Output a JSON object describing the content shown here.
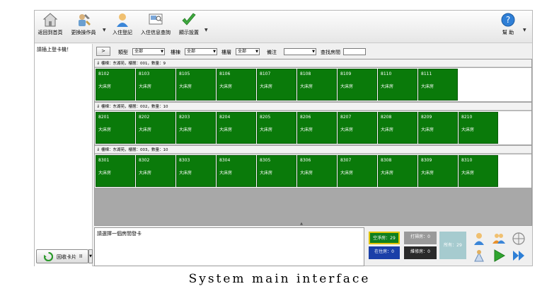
{
  "toolbar": {
    "items": [
      {
        "label": "返回到首頁",
        "icon": "home-icon"
      },
      {
        "label": "更換操作員",
        "icon": "change-operator-icon"
      },
      {
        "label": "入住登記",
        "icon": "user-checkin-icon"
      },
      {
        "label": "入住信息查詢",
        "icon": "search-info-icon"
      },
      {
        "label": "顯示設置",
        "icon": "checkmark-icon"
      }
    ],
    "help_label": "幫 助"
  },
  "left_panel": {
    "prompt": "請插上登卡機！",
    "recycle_label": "回收卡片",
    "recycle_suffix": "II"
  },
  "filter": {
    "next_label": ">",
    "type_label": "類型",
    "type_value": "全部",
    "building_label": "樓棟",
    "building_value": "全部",
    "floor_label": "樓層",
    "floor_value": "全部",
    "note_label": "備注",
    "note_value": "",
    "search_label": "查找房間"
  },
  "floors": [
    {
      "header": "樓棟：东湖苑，樓層：001，數量：9",
      "rooms": [
        {
          "num": "8102",
          "type": "大床房"
        },
        {
          "num": "8103",
          "type": "大床房"
        },
        {
          "num": "8105",
          "type": "大床房"
        },
        {
          "num": "8106",
          "type": "大床房"
        },
        {
          "num": "8107",
          "type": "大床房"
        },
        {
          "num": "8108",
          "type": "大床房"
        },
        {
          "num": "8109",
          "type": "大床房"
        },
        {
          "num": "8110",
          "type": "大床房"
        },
        {
          "num": "8111",
          "type": "大床房"
        }
      ]
    },
    {
      "header": "樓棟：东湖苑，樓層：002，數量：10",
      "rooms": [
        {
          "num": "8201",
          "type": "大床房"
        },
        {
          "num": "8202",
          "type": "大床房"
        },
        {
          "num": "8203",
          "type": "大床房"
        },
        {
          "num": "8204",
          "type": "大床房"
        },
        {
          "num": "8205",
          "type": "大床房"
        },
        {
          "num": "8206",
          "type": "大床房"
        },
        {
          "num": "8207",
          "type": "大床房"
        },
        {
          "num": "8208",
          "type": "大床房"
        },
        {
          "num": "8209",
          "type": "大床房"
        },
        {
          "num": "8210",
          "type": "大床房"
        }
      ]
    },
    {
      "header": "樓棟：东湖苑，樓層：003，數量：10",
      "rooms": [
        {
          "num": "8301",
          "type": "大床房"
        },
        {
          "num": "8302",
          "type": "大床房"
        },
        {
          "num": "8303",
          "type": "大床房"
        },
        {
          "num": "8304",
          "type": "大床房"
        },
        {
          "num": "8305",
          "type": "大床房"
        },
        {
          "num": "8306",
          "type": "大床房"
        },
        {
          "num": "8307",
          "type": "大床房"
        },
        {
          "num": "8308",
          "type": "大床房"
        },
        {
          "num": "8309",
          "type": "大床房"
        },
        {
          "num": "8310",
          "type": "大床房"
        }
      ]
    }
  ],
  "message": "請選擇一個房間發卡",
  "legend": {
    "vacant": "空淨房：29",
    "cleaning": "打掃房：0",
    "occupied": "在住房：0",
    "repair": "維修房：0",
    "all": "所有：29"
  },
  "colors": {
    "room_green": "#0a7a0a",
    "vacant": "#0f7f1e",
    "cleaning": "#9a9a9a",
    "occupied": "#1a3fa8",
    "repair": "#2a2a2a",
    "all": "#a6cbcf"
  },
  "caption": "System main interface"
}
